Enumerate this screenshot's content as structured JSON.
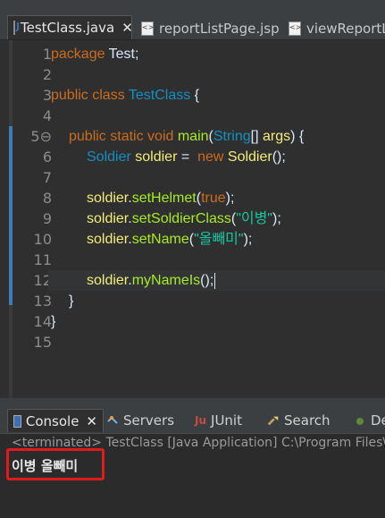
{
  "editor_tabs": [
    {
      "label": "TestClass.java",
      "icon": "java-file-icon",
      "active": true,
      "close": "✕"
    },
    {
      "label": "reportListPage.jsp",
      "icon": "jsp-file-icon",
      "active": false
    },
    {
      "label": "viewReportLis",
      "icon": "jsp-file-icon",
      "active": false
    }
  ],
  "code_lines": [
    {
      "n": "1"
    },
    {
      "n": "2"
    },
    {
      "n": "3"
    },
    {
      "n": "4"
    },
    {
      "n": "5⊖"
    },
    {
      "n": "6"
    },
    {
      "n": "7"
    },
    {
      "n": "8"
    },
    {
      "n": "9"
    },
    {
      "n": "10"
    },
    {
      "n": "11"
    },
    {
      "n": "12"
    },
    {
      "n": "13"
    },
    {
      "n": "14"
    },
    {
      "n": "15"
    }
  ],
  "code": {
    "l1_kw": "package",
    "l1_rest": " Test;",
    "l3_kw": "public class",
    "l3_cls": "TestClass",
    "l3_rest": " {",
    "l5_kw": "public static void",
    "l5_mth": "main",
    "l5_p1": "(",
    "l5_type": "String",
    "l5_p2": "[] ",
    "l5_arg": "args",
    "l5_p3": ") {",
    "l6_cls": "Soldier",
    "l6_var": "soldier",
    "l6_eq": " =  ",
    "l6_kw": "new",
    "l6_ctor": "Soldier",
    "l6_end": "();",
    "l8_var": "soldier",
    "l8_dot": ".",
    "l8_mth": "setHelmet",
    "l8_p1": "(",
    "l8_kw": "true",
    "l8_end": ");",
    "l9_var": "soldier",
    "l9_dot": ".",
    "l9_mth": "setSoldierClass",
    "l9_p1": "(",
    "l9_str": "\"이병\"",
    "l9_end": ");",
    "l10_var": "soldier",
    "l10_dot": ".",
    "l10_mth": "setName",
    "l10_p1": "(",
    "l10_str": "\"올빼미\"",
    "l10_end": ");",
    "l12_var": "soldier",
    "l12_dot": ".",
    "l12_mth": "myNameIs",
    "l12_end": "();",
    "l13": "}",
    "l14": "}"
  },
  "console_tabs": [
    {
      "label": "Console",
      "icon": "console-icon",
      "active": true,
      "close": "✕"
    },
    {
      "label": "Servers",
      "icon": "servers-icon"
    },
    {
      "label": "JUnit",
      "icon": "junit-icon",
      "prefix": "Ju"
    },
    {
      "label": "Search",
      "icon": "search-icon"
    },
    {
      "label": "De",
      "icon": "debug-icon"
    }
  ],
  "console": {
    "terminated": "<terminated> TestClass [Java Application] C:\\Program Files\\",
    "output": "이병 올빼미"
  },
  "colors": {
    "keyword": "#cc6c1d",
    "class": "#1290c3",
    "method": "#a7ec21",
    "variable": "#f3ec79",
    "string": "#17c6a3",
    "highlight_box": "#e01b1b"
  }
}
